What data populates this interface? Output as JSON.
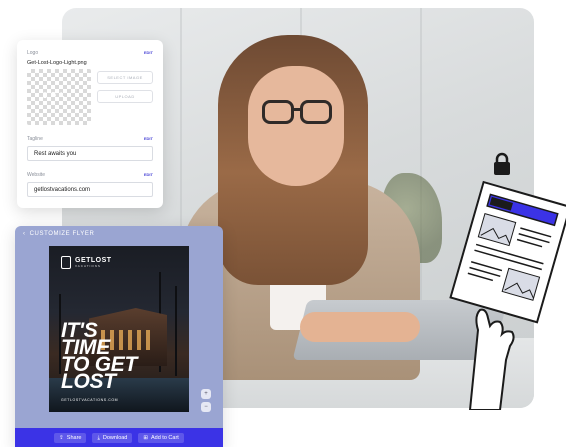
{
  "logo": {
    "label": "Logo",
    "edit_label": "EDIT",
    "file_name": "Get-Lost-Logo-Light.png",
    "select_label": "SELECT IMAGE",
    "upload_label": "UPLOAD"
  },
  "tagline": {
    "label": "Tagline",
    "edit_label": "EDIT",
    "value": "Rest awaits you"
  },
  "website": {
    "label": "Website",
    "edit_label": "EDIT",
    "value": "getlostvacations.com"
  },
  "flyer_panel": {
    "header": "CUSTOMIZE FLYER",
    "flyer": {
      "brand_line1": "GETLOST",
      "brand_line2": "VACATIONS",
      "headline": [
        "IT'S",
        "TIME",
        "TO GET",
        "LOST"
      ],
      "url": "GETLOSTVACATIONS.COM"
    },
    "toolbar": {
      "share": "Share",
      "download": "Download",
      "add_to_cart": "Add to Cart"
    }
  },
  "colors": {
    "accent": "#3b33e6",
    "panel": "#9aa5d2"
  },
  "icons": [
    "lock-icon",
    "document-icon",
    "hand-icon",
    "zoom-in-icon",
    "zoom-out-icon",
    "share-icon",
    "download-icon",
    "cart-icon",
    "back-chevron-icon"
  ]
}
